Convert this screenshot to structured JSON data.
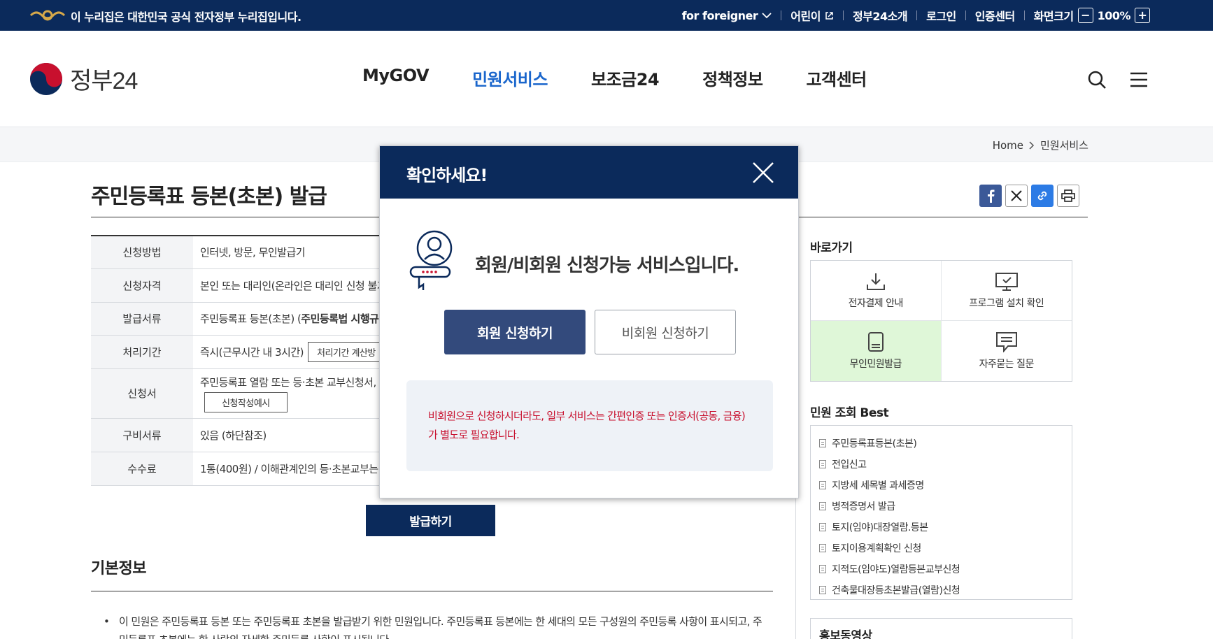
{
  "govbar": {
    "notice": "이 누리집은 대한민국 공식 전자정부 누리집입니다.",
    "foreigner": "for foreigner",
    "kids": "어린이",
    "about": "정부24소개",
    "login": "로그인",
    "cert": "인증센터",
    "zoom_label": "화면크기",
    "zoom_minus": "−",
    "zoom_value": "100%",
    "zoom_plus": "+"
  },
  "header": {
    "brand": "정부24",
    "nav": [
      "MyGOV",
      "민원서비스",
      "보조금24",
      "정책정보",
      "고객센터"
    ],
    "active_nav": "민원서비스"
  },
  "breadcrumb": {
    "home": "Home",
    "current": "민원서비스"
  },
  "page": {
    "title": "주민등록표 등본(초본) 발급",
    "issue_button": "발급하기",
    "section_title": "기본정보",
    "desc_line1": "이 민원은 주민등록표 등본 또는 주민등록표 초본을 발급받기 위한 민원입니다. 주민등록표 등본에는 한 세대의 모든 구성원의 주민등록 사항이 표시되고, 주",
    "desc_line2": "민등록표 초본에는 한 사람의 자세한 주민등록 사항이 표시됩니다."
  },
  "info_table": {
    "method_label": "신청방법",
    "method_value": "인터넷, 방문, 무인발급기",
    "elig_label": "신청자격",
    "elig_value": "본인 또는 대리인(온라인은 대리인 신청 불가",
    "doc_label": "발급서류",
    "doc_value": "주민등록표 등본(초본) (",
    "doc_bold": "주민등록법 시행규",
    "time_label": "처리기간",
    "time_value": "즉시(근무시간 내 3시간)",
    "time_btn": "처리기간 계산방",
    "form_label": "신청서",
    "form_value": "주민등록표 열람 또는 등·초본 교부신청서, ",
    "form_btn": "신청작성예시",
    "req_label": "구비서류",
    "req_value": "있음 (하단참조)",
    "fee_label": "수수료",
    "fee_value": "1통(400원) / 이해관계인의 등·초본교부는"
  },
  "sidebar": {
    "quick_title": "바로가기",
    "quick": [
      "전자결제 안내",
      "프로그램 설치 확인",
      "무인민원발급",
      "자주묻는 질문"
    ],
    "best_title": "민원 조회 Best",
    "best": [
      "주민등록표등본(초본)",
      "전입신고",
      "지방세 세목별 과세증명",
      "병적증명서 발급",
      "토지(임야)대장열람.등본",
      "토지이용계획확인 신청",
      "지적도(임야도)열람등본교부신청",
      "건축물대장등초본발급(열람)신청"
    ],
    "promo_title": "홍보동영상"
  },
  "modal": {
    "title": "확인하세요!",
    "lead": "회원/비회원 신청가능 서비스입니다.",
    "member_button": "회원 신청하기",
    "guest_button": "비회원 신청하기",
    "warning_line1": "비회원으로 신청하시더라도, 일부 서비스는 간편인증 또는 인증서(공동, 금융)",
    "warning_line2": "가 별도로 필요합니다."
  },
  "colors": {
    "navy": "#0b2a5b",
    "active": "#1a66cc",
    "member_btn": "#334a7c",
    "warning": "#c8102e",
    "highlight": "#dff7d8"
  }
}
